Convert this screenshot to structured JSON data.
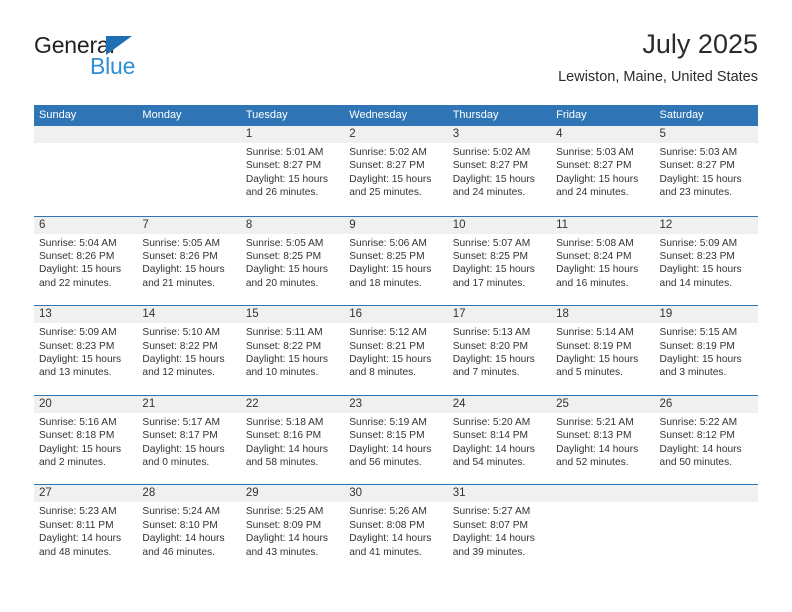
{
  "logo": {
    "word_top": "General",
    "word_bottom": "Blue",
    "triangle_color": "#1f6fb5",
    "blue_text_color": "#2e8fd4"
  },
  "header": {
    "title": "July 2025",
    "subtitle": "Lewiston, Maine, United States"
  },
  "theme": {
    "header_blue": "#2f75b5",
    "day_band_gray": "#f0f0f0",
    "text_color": "#333333"
  },
  "weekdays": [
    "Sunday",
    "Monday",
    "Tuesday",
    "Wednesday",
    "Thursday",
    "Friday",
    "Saturday"
  ],
  "weeks": [
    [
      {
        "day": "",
        "empty": true,
        "sunrise": "",
        "sunset": "",
        "daylight_line1": "",
        "daylight_line2": ""
      },
      {
        "day": "",
        "empty": true,
        "sunrise": "",
        "sunset": "",
        "daylight_line1": "",
        "daylight_line2": ""
      },
      {
        "day": "1",
        "empty": false,
        "sunrise": "Sunrise: 5:01 AM",
        "sunset": "Sunset: 8:27 PM",
        "daylight_line1": "Daylight: 15 hours",
        "daylight_line2": "and 26 minutes."
      },
      {
        "day": "2",
        "empty": false,
        "sunrise": "Sunrise: 5:02 AM",
        "sunset": "Sunset: 8:27 PM",
        "daylight_line1": "Daylight: 15 hours",
        "daylight_line2": "and 25 minutes."
      },
      {
        "day": "3",
        "empty": false,
        "sunrise": "Sunrise: 5:02 AM",
        "sunset": "Sunset: 8:27 PM",
        "daylight_line1": "Daylight: 15 hours",
        "daylight_line2": "and 24 minutes."
      },
      {
        "day": "4",
        "empty": false,
        "sunrise": "Sunrise: 5:03 AM",
        "sunset": "Sunset: 8:27 PM",
        "daylight_line1": "Daylight: 15 hours",
        "daylight_line2": "and 24 minutes."
      },
      {
        "day": "5",
        "empty": false,
        "sunrise": "Sunrise: 5:03 AM",
        "sunset": "Sunset: 8:27 PM",
        "daylight_line1": "Daylight: 15 hours",
        "daylight_line2": "and 23 minutes."
      }
    ],
    [
      {
        "day": "6",
        "empty": false,
        "sunrise": "Sunrise: 5:04 AM",
        "sunset": "Sunset: 8:26 PM",
        "daylight_line1": "Daylight: 15 hours",
        "daylight_line2": "and 22 minutes."
      },
      {
        "day": "7",
        "empty": false,
        "sunrise": "Sunrise: 5:05 AM",
        "sunset": "Sunset: 8:26 PM",
        "daylight_line1": "Daylight: 15 hours",
        "daylight_line2": "and 21 minutes."
      },
      {
        "day": "8",
        "empty": false,
        "sunrise": "Sunrise: 5:05 AM",
        "sunset": "Sunset: 8:25 PM",
        "daylight_line1": "Daylight: 15 hours",
        "daylight_line2": "and 20 minutes."
      },
      {
        "day": "9",
        "empty": false,
        "sunrise": "Sunrise: 5:06 AM",
        "sunset": "Sunset: 8:25 PM",
        "daylight_line1": "Daylight: 15 hours",
        "daylight_line2": "and 18 minutes."
      },
      {
        "day": "10",
        "empty": false,
        "sunrise": "Sunrise: 5:07 AM",
        "sunset": "Sunset: 8:25 PM",
        "daylight_line1": "Daylight: 15 hours",
        "daylight_line2": "and 17 minutes."
      },
      {
        "day": "11",
        "empty": false,
        "sunrise": "Sunrise: 5:08 AM",
        "sunset": "Sunset: 8:24 PM",
        "daylight_line1": "Daylight: 15 hours",
        "daylight_line2": "and 16 minutes."
      },
      {
        "day": "12",
        "empty": false,
        "sunrise": "Sunrise: 5:09 AM",
        "sunset": "Sunset: 8:23 PM",
        "daylight_line1": "Daylight: 15 hours",
        "daylight_line2": "and 14 minutes."
      }
    ],
    [
      {
        "day": "13",
        "empty": false,
        "sunrise": "Sunrise: 5:09 AM",
        "sunset": "Sunset: 8:23 PM",
        "daylight_line1": "Daylight: 15 hours",
        "daylight_line2": "and 13 minutes."
      },
      {
        "day": "14",
        "empty": false,
        "sunrise": "Sunrise: 5:10 AM",
        "sunset": "Sunset: 8:22 PM",
        "daylight_line1": "Daylight: 15 hours",
        "daylight_line2": "and 12 minutes."
      },
      {
        "day": "15",
        "empty": false,
        "sunrise": "Sunrise: 5:11 AM",
        "sunset": "Sunset: 8:22 PM",
        "daylight_line1": "Daylight: 15 hours",
        "daylight_line2": "and 10 minutes."
      },
      {
        "day": "16",
        "empty": false,
        "sunrise": "Sunrise: 5:12 AM",
        "sunset": "Sunset: 8:21 PM",
        "daylight_line1": "Daylight: 15 hours",
        "daylight_line2": "and 8 minutes."
      },
      {
        "day": "17",
        "empty": false,
        "sunrise": "Sunrise: 5:13 AM",
        "sunset": "Sunset: 8:20 PM",
        "daylight_line1": "Daylight: 15 hours",
        "daylight_line2": "and 7 minutes."
      },
      {
        "day": "18",
        "empty": false,
        "sunrise": "Sunrise: 5:14 AM",
        "sunset": "Sunset: 8:19 PM",
        "daylight_line1": "Daylight: 15 hours",
        "daylight_line2": "and 5 minutes."
      },
      {
        "day": "19",
        "empty": false,
        "sunrise": "Sunrise: 5:15 AM",
        "sunset": "Sunset: 8:19 PM",
        "daylight_line1": "Daylight: 15 hours",
        "daylight_line2": "and 3 minutes."
      }
    ],
    [
      {
        "day": "20",
        "empty": false,
        "sunrise": "Sunrise: 5:16 AM",
        "sunset": "Sunset: 8:18 PM",
        "daylight_line1": "Daylight: 15 hours",
        "daylight_line2": "and 2 minutes."
      },
      {
        "day": "21",
        "empty": false,
        "sunrise": "Sunrise: 5:17 AM",
        "sunset": "Sunset: 8:17 PM",
        "daylight_line1": "Daylight: 15 hours",
        "daylight_line2": "and 0 minutes."
      },
      {
        "day": "22",
        "empty": false,
        "sunrise": "Sunrise: 5:18 AM",
        "sunset": "Sunset: 8:16 PM",
        "daylight_line1": "Daylight: 14 hours",
        "daylight_line2": "and 58 minutes."
      },
      {
        "day": "23",
        "empty": false,
        "sunrise": "Sunrise: 5:19 AM",
        "sunset": "Sunset: 8:15 PM",
        "daylight_line1": "Daylight: 14 hours",
        "daylight_line2": "and 56 minutes."
      },
      {
        "day": "24",
        "empty": false,
        "sunrise": "Sunrise: 5:20 AM",
        "sunset": "Sunset: 8:14 PM",
        "daylight_line1": "Daylight: 14 hours",
        "daylight_line2": "and 54 minutes."
      },
      {
        "day": "25",
        "empty": false,
        "sunrise": "Sunrise: 5:21 AM",
        "sunset": "Sunset: 8:13 PM",
        "daylight_line1": "Daylight: 14 hours",
        "daylight_line2": "and 52 minutes."
      },
      {
        "day": "26",
        "empty": false,
        "sunrise": "Sunrise: 5:22 AM",
        "sunset": "Sunset: 8:12 PM",
        "daylight_line1": "Daylight: 14 hours",
        "daylight_line2": "and 50 minutes."
      }
    ],
    [
      {
        "day": "27",
        "empty": false,
        "sunrise": "Sunrise: 5:23 AM",
        "sunset": "Sunset: 8:11 PM",
        "daylight_line1": "Daylight: 14 hours",
        "daylight_line2": "and 48 minutes."
      },
      {
        "day": "28",
        "empty": false,
        "sunrise": "Sunrise: 5:24 AM",
        "sunset": "Sunset: 8:10 PM",
        "daylight_line1": "Daylight: 14 hours",
        "daylight_line2": "and 46 minutes."
      },
      {
        "day": "29",
        "empty": false,
        "sunrise": "Sunrise: 5:25 AM",
        "sunset": "Sunset: 8:09 PM",
        "daylight_line1": "Daylight: 14 hours",
        "daylight_line2": "and 43 minutes."
      },
      {
        "day": "30",
        "empty": false,
        "sunrise": "Sunrise: 5:26 AM",
        "sunset": "Sunset: 8:08 PM",
        "daylight_line1": "Daylight: 14 hours",
        "daylight_line2": "and 41 minutes."
      },
      {
        "day": "31",
        "empty": false,
        "sunrise": "Sunrise: 5:27 AM",
        "sunset": "Sunset: 8:07 PM",
        "daylight_line1": "Daylight: 14 hours",
        "daylight_line2": "and 39 minutes."
      },
      {
        "day": "",
        "empty": true,
        "sunrise": "",
        "sunset": "",
        "daylight_line1": "",
        "daylight_line2": ""
      },
      {
        "day": "",
        "empty": true,
        "sunrise": "",
        "sunset": "",
        "daylight_line1": "",
        "daylight_line2": ""
      }
    ]
  ]
}
